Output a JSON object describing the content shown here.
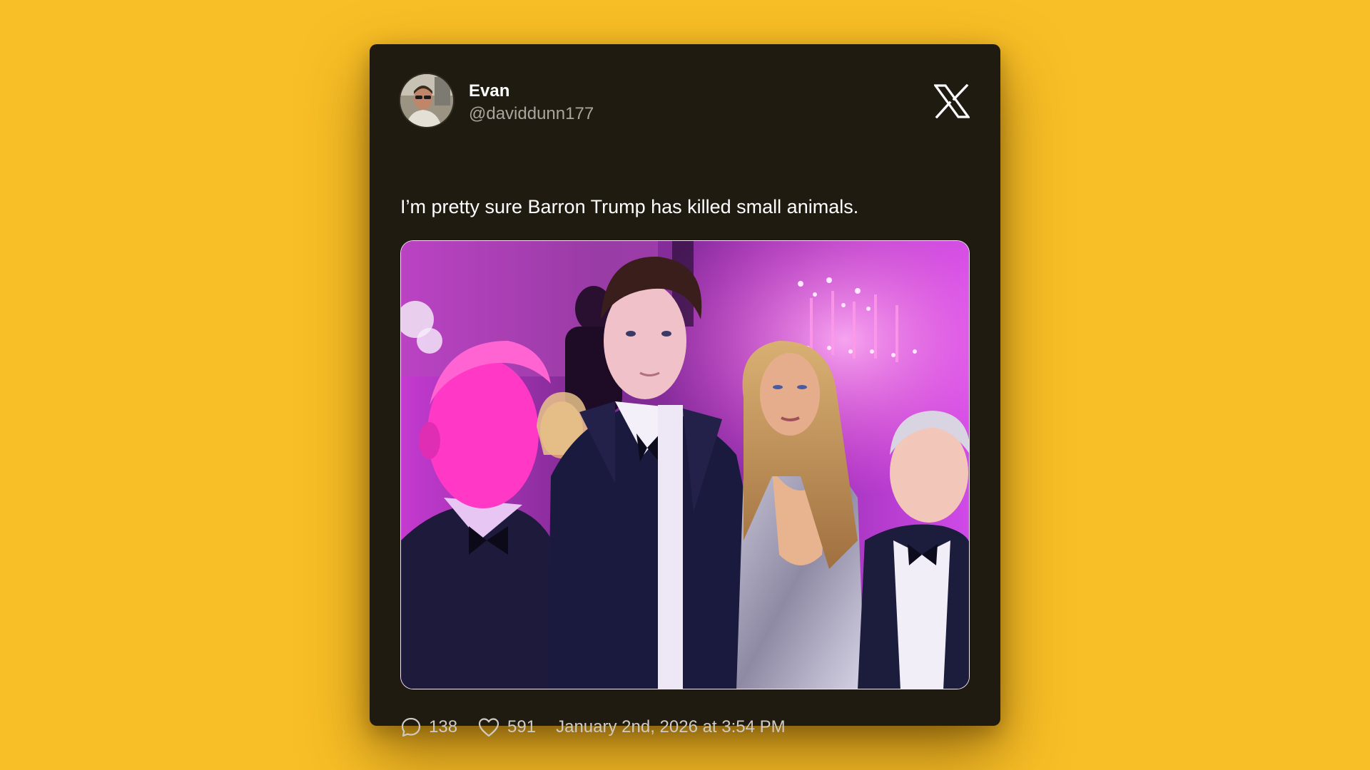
{
  "author": {
    "display_name": "Evan",
    "handle": "@daviddunn177"
  },
  "tweet": {
    "text": "I’m pretty sure Barron Trump has killed small animals."
  },
  "stats": {
    "replies": "138",
    "likes": "591",
    "timestamp": "January 2nd, 2026 at 3:54 PM"
  },
  "icons": {
    "brand": "x-logo-icon",
    "reply": "speech-bubble-icon",
    "like": "heart-icon"
  },
  "colors": {
    "background": "#F9BF26",
    "card": "#201b10",
    "text_primary": "#ffffff",
    "text_secondary": "#a8a59f"
  }
}
